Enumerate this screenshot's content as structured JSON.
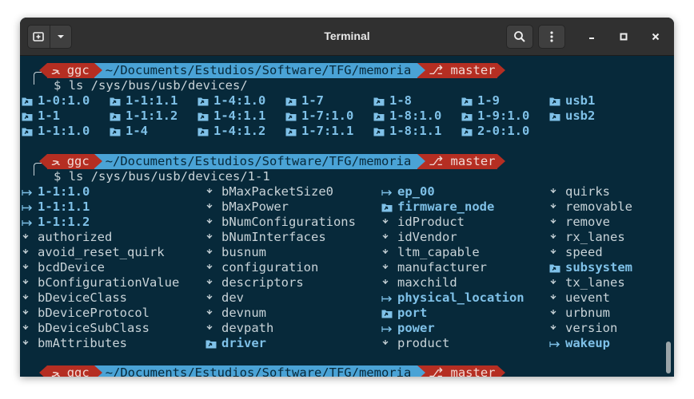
{
  "window": {
    "title": "Terminal"
  },
  "prompt": {
    "user": "ggc",
    "path": "~/Documents/Estudios/Software/TFG/memoria",
    "branch": "master",
    "symbol": "$"
  },
  "commands": {
    "first": "ls /sys/bus/usb/devices/",
    "second": "ls /sys/bus/usb/devices/1-1"
  },
  "listing1": [
    [
      "1-0:1.0",
      "1-1:1.1",
      "1-4:1.0",
      "1-7",
      "1-8",
      "1-9",
      "usb1"
    ],
    [
      "1-1",
      "1-1:1.2",
      "1-4:1.1",
      "1-7:1.0",
      "1-8:1.0",
      "1-9:1.0",
      "usb2"
    ],
    [
      "1-1:1.0",
      "1-4",
      "1-4:1.2",
      "1-7:1.1",
      "1-8:1.1",
      "2-0:1.0",
      ""
    ]
  ],
  "listing2": [
    [
      {
        "t": "1-1:1.0",
        "k": "link"
      },
      {
        "t": "bMaxPacketSize0",
        "k": "file"
      },
      {
        "t": "ep_00",
        "k": "link"
      },
      {
        "t": "quirks",
        "k": "file"
      }
    ],
    [
      {
        "t": "1-1:1.1",
        "k": "link"
      },
      {
        "t": "bMaxPower",
        "k": "file"
      },
      {
        "t": "firmware_node",
        "k": "dirlink"
      },
      {
        "t": "removable",
        "k": "file"
      }
    ],
    [
      {
        "t": "1-1:1.2",
        "k": "link"
      },
      {
        "t": "bNumConfigurations",
        "k": "file"
      },
      {
        "t": "idProduct",
        "k": "file"
      },
      {
        "t": "remove",
        "k": "file"
      }
    ],
    [
      {
        "t": "authorized",
        "k": "file"
      },
      {
        "t": "bNumInterfaces",
        "k": "file"
      },
      {
        "t": "idVendor",
        "k": "file"
      },
      {
        "t": "rx_lanes",
        "k": "file"
      }
    ],
    [
      {
        "t": "avoid_reset_quirk",
        "k": "file"
      },
      {
        "t": "busnum",
        "k": "file"
      },
      {
        "t": "ltm_capable",
        "k": "file"
      },
      {
        "t": "speed",
        "k": "file"
      }
    ],
    [
      {
        "t": "bcdDevice",
        "k": "file"
      },
      {
        "t": "configuration",
        "k": "file"
      },
      {
        "t": "manufacturer",
        "k": "file"
      },
      {
        "t": "subsystem",
        "k": "dirlink"
      }
    ],
    [
      {
        "t": "bConfigurationValue",
        "k": "file"
      },
      {
        "t": "descriptors",
        "k": "file"
      },
      {
        "t": "maxchild",
        "k": "file"
      },
      {
        "t": "tx_lanes",
        "k": "file"
      }
    ],
    [
      {
        "t": "bDeviceClass",
        "k": "file"
      },
      {
        "t": "dev",
        "k": "file"
      },
      {
        "t": "physical_location",
        "k": "link"
      },
      {
        "t": "uevent",
        "k": "file"
      }
    ],
    [
      {
        "t": "bDeviceProtocol",
        "k": "file"
      },
      {
        "t": "devnum",
        "k": "file"
      },
      {
        "t": "port",
        "k": "dirlink"
      },
      {
        "t": "urbnum",
        "k": "file"
      }
    ],
    [
      {
        "t": "bDeviceSubClass",
        "k": "file"
      },
      {
        "t": "devpath",
        "k": "file"
      },
      {
        "t": "power",
        "k": "link"
      },
      {
        "t": "version",
        "k": "file"
      }
    ],
    [
      {
        "t": "bmAttributes",
        "k": "file"
      },
      {
        "t": "driver",
        "k": "dirlink"
      },
      {
        "t": "product",
        "k": "file"
      },
      {
        "t": "wakeup",
        "k": "link"
      }
    ]
  ],
  "colors": {
    "background": "#07293a",
    "directory": "#7fc1e8",
    "segment_red": "#b52e22",
    "segment_blue": "#4aa3d6",
    "text": "#c8d3d8"
  },
  "icons": {
    "directory": "folder-link-icon",
    "symlink": "symlink-arrow-icon",
    "file": "file-glyph-icon",
    "user": "user-glyph-icon",
    "branch": "git-branch-icon"
  }
}
